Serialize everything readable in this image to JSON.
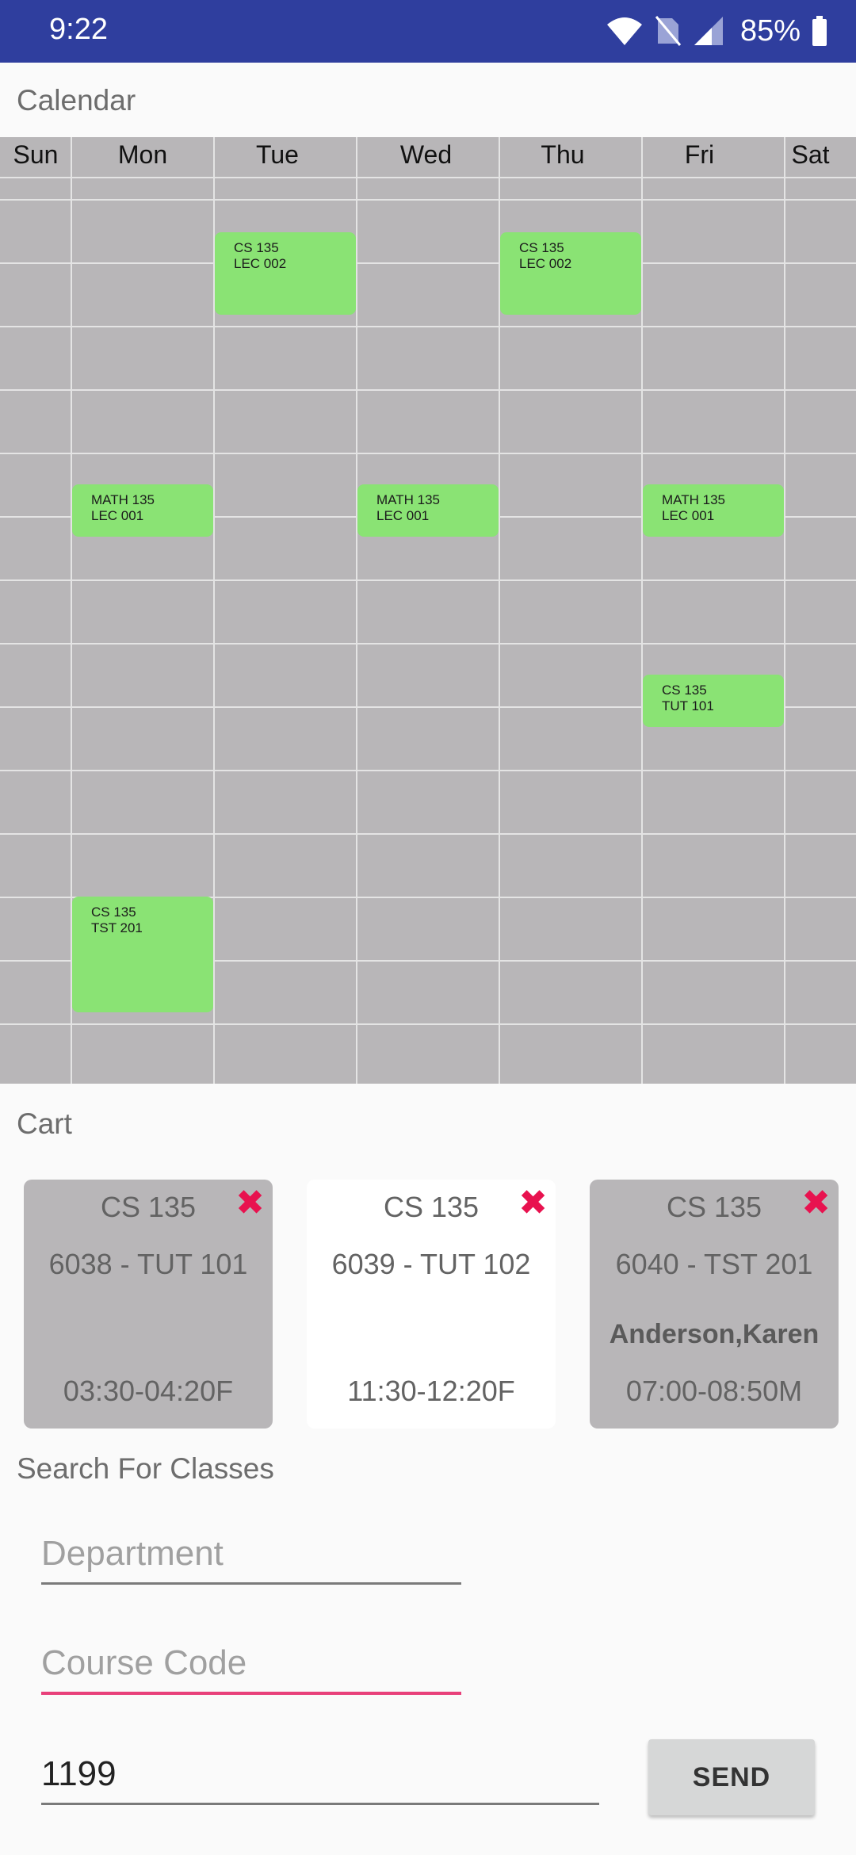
{
  "status_bar": {
    "time": "9:22",
    "battery": "85%",
    "icons": [
      "wifi-icon",
      "no-sim-icon",
      "signal-icon",
      "battery-icon"
    ],
    "color": "#2f3e9e"
  },
  "calendar": {
    "label": "Calendar",
    "days": [
      "Sun",
      "Mon",
      "Tue",
      "Wed",
      "Thu",
      "Fri",
      "Sat"
    ],
    "events": [
      {
        "day": "Tue",
        "course": "CS 135",
        "section": "LEC 002"
      },
      {
        "day": "Thu",
        "course": "CS 135",
        "section": "LEC 002"
      },
      {
        "day": "Mon",
        "course": "MATH 135",
        "section": "LEC 001"
      },
      {
        "day": "Wed",
        "course": "MATH 135",
        "section": "LEC 001"
      },
      {
        "day": "Fri",
        "course": "MATH 135",
        "section": "LEC 001"
      },
      {
        "day": "Fri",
        "course": "CS 135",
        "section": "TUT 101"
      },
      {
        "day": "Mon",
        "course": "CS 135",
        "section": "TST 201"
      }
    ],
    "event_color": "#8ae374",
    "background_color": "#b8b6b8"
  },
  "cart": {
    "label": "Cart",
    "items": [
      {
        "course": "CS 135",
        "section": "6038 - TUT 101",
        "instructor": "",
        "time": "03:30-04:20F",
        "remove_icon": "close-icon"
      },
      {
        "course": "CS 135",
        "section": "6039 - TUT 102",
        "instructor": "",
        "time": "11:30-12:20F",
        "remove_icon": "close-icon"
      },
      {
        "course": "CS 135",
        "section": "6040 - TST 201",
        "instructor": "Anderson,Karen",
        "time": "07:00-08:50M",
        "remove_icon": "close-icon"
      }
    ],
    "remove_color": "#e8124f"
  },
  "search": {
    "label": "Search For Classes",
    "department_placeholder": "Department",
    "course_code_placeholder": "Course Code",
    "class_number_value": "1199",
    "send_label": "SEND",
    "focus_color": "#e8407a"
  }
}
